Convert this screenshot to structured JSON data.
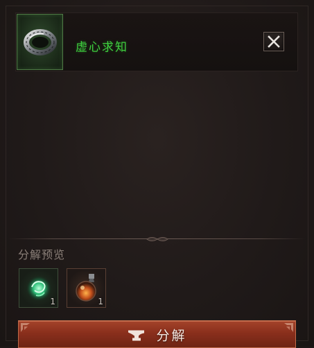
{
  "item": {
    "name": "虚心求知",
    "icon": "ring-icon",
    "name_color": "#3fcf3f"
  },
  "close_button": {
    "icon": "close-icon"
  },
  "preview": {
    "title": "分解预览",
    "rewards": [
      {
        "icon": "green-swirl-orb-icon",
        "count": "1"
      },
      {
        "icon": "orange-potion-flask-icon",
        "count": "1"
      }
    ]
  },
  "action": {
    "label": "分解",
    "icon": "anvil-icon",
    "color": "#8a2f1c"
  }
}
